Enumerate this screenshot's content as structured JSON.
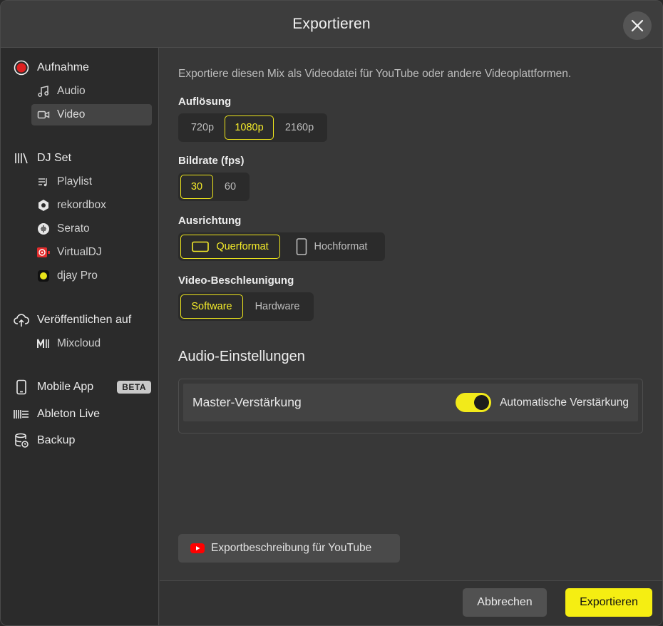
{
  "dialog": {
    "title": "Exportieren",
    "close_icon": "close-icon"
  },
  "sidebar": {
    "recording": {
      "label": "Aufnahme",
      "icon": "record-icon",
      "items": [
        {
          "label": "Audio",
          "icon": "music-note-icon"
        },
        {
          "label": "Video",
          "icon": "video-camera-icon",
          "active": true
        }
      ]
    },
    "djset": {
      "label": "DJ Set",
      "icon": "library-icon",
      "items": [
        {
          "label": "Playlist",
          "icon": "playlist-icon"
        },
        {
          "label": "rekordbox",
          "icon": "rekordbox-icon"
        },
        {
          "label": "Serato",
          "icon": "serato-icon"
        },
        {
          "label": "VirtualDJ",
          "icon": "virtualdj-icon"
        },
        {
          "label": "djay Pro",
          "icon": "djay-icon"
        }
      ]
    },
    "publish": {
      "label": "Veröffentlichen auf",
      "icon": "cloud-upload-icon",
      "items": [
        {
          "label": "Mixcloud",
          "icon": "mixcloud-icon"
        }
      ]
    },
    "mobile": {
      "label": "Mobile App",
      "badge": "BETA",
      "icon": "mobile-icon"
    },
    "ableton": {
      "label": "Ableton Live",
      "icon": "ableton-icon"
    },
    "backup": {
      "label": "Backup",
      "icon": "database-backup-icon"
    }
  },
  "main": {
    "description": "Exportiere diesen Mix als Videodatei für YouTube oder andere Videoplattformen.",
    "resolution": {
      "label": "Auflösung",
      "options": [
        "720p",
        "1080p",
        "2160p"
      ],
      "selected": "1080p"
    },
    "framerate": {
      "label": "Bildrate (fps)",
      "options": [
        "30",
        "60"
      ],
      "selected": "30"
    },
    "orientation": {
      "label": "Ausrichtung",
      "options": [
        "Querformat",
        "Hochformat"
      ],
      "selected": "Querformat"
    },
    "acceleration": {
      "label": "Video-Beschleunigung",
      "options": [
        "Software",
        "Hardware"
      ],
      "selected": "Software"
    },
    "audio": {
      "title": "Audio-Einstellungen",
      "master_label": "Master-Verstärkung",
      "toggle_label": "Automatische Verstärkung",
      "toggle_on": true
    },
    "youtube_button": "Exportbeschreibung für YouTube"
  },
  "footer": {
    "cancel": "Abbrechen",
    "export": "Exportieren"
  },
  "colors": {
    "accent": "#f5ee12",
    "background": "#383838",
    "sidebar": "#2b2b2b",
    "record_red": "#e02020",
    "youtube_red": "#ff0000"
  }
}
